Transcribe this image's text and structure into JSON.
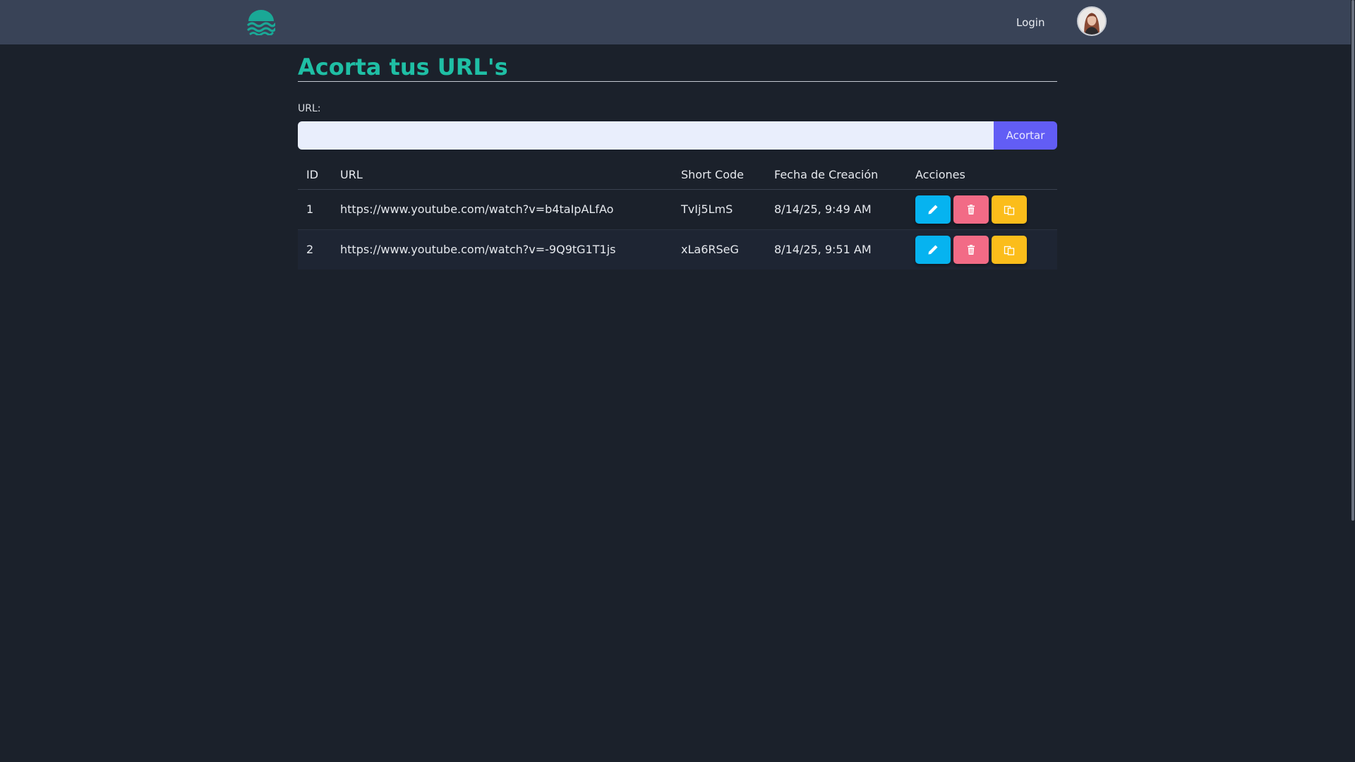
{
  "navbar": {
    "logo_icon": "waves-logo-icon",
    "login_label": "Login",
    "avatar_icon": "user-avatar"
  },
  "main": {
    "title": "Acorta tus URL's",
    "url_label": "URL:",
    "url_input": {
      "value": "",
      "placeholder": ""
    },
    "shorten_label": "Acortar"
  },
  "table": {
    "headers": [
      "ID",
      "URL",
      "Short Code",
      "Fecha de Creación",
      "Acciones"
    ],
    "rows": [
      {
        "id": "1",
        "url": "https://www.youtube.com/watch?v=b4taIpALfAo",
        "short_code": "TvIj5LmS",
        "created": "8/14/25, 9:49 AM"
      },
      {
        "id": "2",
        "url": "https://www.youtube.com/watch?v=-9Q9tG1T1js",
        "short_code": "xLa6RSeG",
        "created": "8/14/25, 9:51 AM"
      }
    ],
    "action_icons": [
      "pencil-icon",
      "trash-icon",
      "copy-icon"
    ]
  },
  "colors": {
    "accent": "#1fbfa5",
    "navbar": "#394357",
    "background": "#1b212b",
    "primary_button": "#625df5",
    "edit": "#06b3f0",
    "delete": "#f26b86",
    "copy": "#fbbd1b"
  }
}
